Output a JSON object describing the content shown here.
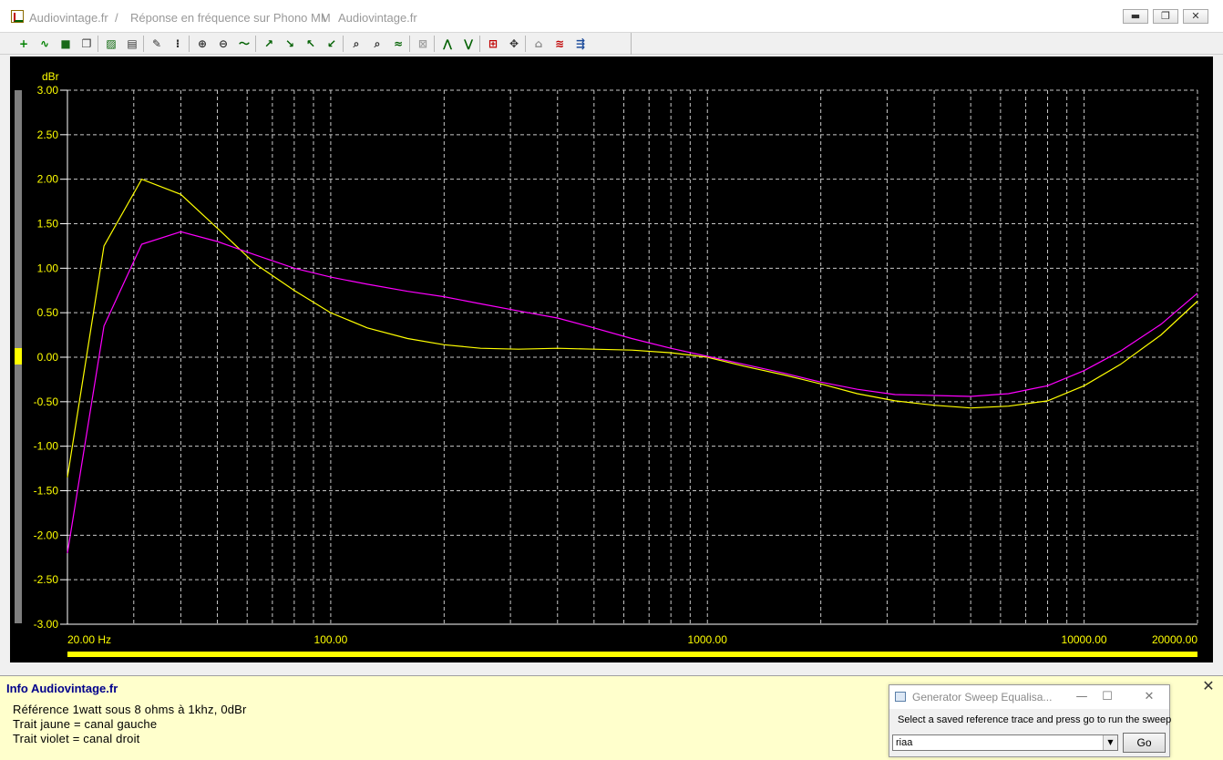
{
  "window": {
    "title_parts": [
      "Audiovintage.fr",
      "/",
      "Réponse en fréquence sur Phono MM",
      "\\",
      "Audiovintage.fr"
    ]
  },
  "window_controls": {
    "minimize": "▬",
    "restore": "❐",
    "close": "✕"
  },
  "toolbar": {
    "groups": [
      [
        {
          "name": "add-trace-icon",
          "glyph": "+",
          "color": "#008000"
        },
        {
          "name": "wave-icon",
          "glyph": "∿",
          "color": "#008000"
        },
        {
          "name": "save-icon",
          "glyph": "■",
          "color": "#1a6a1a"
        },
        {
          "name": "copy-icon",
          "glyph": "❐",
          "color": "#333333"
        }
      ],
      [
        {
          "name": "graph-view-icon",
          "glyph": "▨",
          "color": "#006000"
        },
        {
          "name": "graph-compare-icon",
          "glyph": "▤",
          "color": "#333333"
        }
      ],
      [
        {
          "name": "edit-sheet-icon",
          "glyph": "✎",
          "color": "#333333"
        },
        {
          "name": "data-table-icon",
          "glyph": "⁝",
          "color": "#333333"
        }
      ],
      [
        {
          "name": "zoom-in-icon",
          "glyph": "⊕",
          "color": "#333333"
        },
        {
          "name": "zoom-out-icon",
          "glyph": "⊖",
          "color": "#333333"
        },
        {
          "name": "zoom-fit-icon",
          "glyph": "〜",
          "color": "#006000"
        }
      ],
      [
        {
          "name": "trace-up-icon",
          "glyph": "↗",
          "color": "#006000"
        },
        {
          "name": "trace-down-icon",
          "glyph": "↘",
          "color": "#006000"
        },
        {
          "name": "trace-left-icon",
          "glyph": "↖",
          "color": "#006000"
        },
        {
          "name": "trace-right-icon",
          "glyph": "↙",
          "color": "#006000"
        }
      ],
      [
        {
          "name": "magnify-plus-icon",
          "glyph": "⌕",
          "color": "#333333"
        },
        {
          "name": "magnify-minus-icon",
          "glyph": "⌕",
          "color": "#333333"
        },
        {
          "name": "scope-icon",
          "glyph": "≈",
          "color": "#006000"
        }
      ],
      [
        {
          "name": "disabled-tool-icon",
          "glyph": "⊠",
          "color": "#a0a0a0"
        }
      ],
      [
        {
          "name": "peak-up-icon",
          "glyph": "⋀",
          "color": "#006000"
        },
        {
          "name": "peak-down-icon",
          "glyph": "⋁",
          "color": "#006000"
        }
      ],
      [
        {
          "name": "marker-icon",
          "glyph": "⊞",
          "color": "#c00000"
        },
        {
          "name": "cursor-move-icon",
          "glyph": "✥",
          "color": "#333333"
        }
      ],
      [
        {
          "name": "shape-grey-icon",
          "glyph": "⌂",
          "color": "#909090"
        },
        {
          "name": "sweep-icon",
          "glyph": "≋",
          "color": "#c00000"
        },
        {
          "name": "settings-icon",
          "glyph": "⇶",
          "color": "#1a4a9a"
        }
      ]
    ]
  },
  "chart_data": {
    "type": "line",
    "ylabel": "dBr",
    "ylim": [
      -3.0,
      3.0
    ],
    "xlim": [
      20,
      20000
    ],
    "x_scale": "log",
    "grid": true,
    "y_ticks": [
      "3.00",
      "2.50",
      "2.00",
      "1.50",
      "1.00",
      "0.50",
      "0.00",
      "-0.50",
      "-1.00",
      "-1.50",
      "-2.00",
      "-2.50",
      "-3.00"
    ],
    "x_tick_labels": [
      {
        "value": 20,
        "label": "20.00 Hz"
      },
      {
        "value": 100,
        "label": "100.00"
      },
      {
        "value": 1000,
        "label": "1000.00"
      },
      {
        "value": 10000,
        "label": "10000.00"
      },
      {
        "value": 20000,
        "label": "20000.00"
      }
    ],
    "series": [
      {
        "color": "#ffff00",
        "points": [
          [
            20,
            -1.35
          ],
          [
            25,
            1.25
          ],
          [
            31.5,
            2.0
          ],
          [
            40,
            1.83
          ],
          [
            50,
            1.45
          ],
          [
            63,
            1.05
          ],
          [
            80,
            0.75
          ],
          [
            100,
            0.5
          ],
          [
            125,
            0.33
          ],
          [
            160,
            0.21
          ],
          [
            200,
            0.14
          ],
          [
            250,
            0.1
          ],
          [
            315,
            0.09
          ],
          [
            400,
            0.1
          ],
          [
            500,
            0.09
          ],
          [
            630,
            0.08
          ],
          [
            800,
            0.05
          ],
          [
            1000,
            0.0
          ],
          [
            1250,
            -0.1
          ],
          [
            1600,
            -0.2
          ],
          [
            2000,
            -0.3
          ],
          [
            2500,
            -0.41
          ],
          [
            3150,
            -0.49
          ],
          [
            4000,
            -0.54
          ],
          [
            5000,
            -0.57
          ],
          [
            6300,
            -0.55
          ],
          [
            8000,
            -0.49
          ],
          [
            10000,
            -0.32
          ],
          [
            12500,
            -0.08
          ],
          [
            16000,
            0.25
          ],
          [
            20000,
            0.63
          ]
        ]
      },
      {
        "color": "#ff00ff",
        "points": [
          [
            20,
            -2.2
          ],
          [
            25,
            0.35
          ],
          [
            31.5,
            1.27
          ],
          [
            40,
            1.41
          ],
          [
            50,
            1.3
          ],
          [
            63,
            1.15
          ],
          [
            80,
            1.0
          ],
          [
            100,
            0.9
          ],
          [
            125,
            0.82
          ],
          [
            160,
            0.74
          ],
          [
            200,
            0.68
          ],
          [
            250,
            0.6
          ],
          [
            315,
            0.52
          ],
          [
            400,
            0.44
          ],
          [
            500,
            0.33
          ],
          [
            630,
            0.21
          ],
          [
            800,
            0.1
          ],
          [
            1000,
            0.01
          ],
          [
            1250,
            -0.08
          ],
          [
            1600,
            -0.18
          ],
          [
            2000,
            -0.28
          ],
          [
            2500,
            -0.36
          ],
          [
            3150,
            -0.42
          ],
          [
            4000,
            -0.43
          ],
          [
            5000,
            -0.44
          ],
          [
            6300,
            -0.41
          ],
          [
            8000,
            -0.32
          ],
          [
            10000,
            -0.15
          ],
          [
            12500,
            0.07
          ],
          [
            16000,
            0.37
          ],
          [
            20000,
            0.72
          ]
        ]
      }
    ]
  },
  "info": {
    "title": "Info Audiovintage.fr",
    "lines": [
      "Référence 1watt sous 8 ohms à 1khz, 0dBr",
      "Trait jaune = canal gauche",
      "Trait violet = canal droit"
    ],
    "close_glyph": "✕"
  },
  "dialog": {
    "title": "Generator Sweep Equalisa...",
    "prompt": "Select a saved reference trace and press go to run the sweep",
    "select_value": "riaa",
    "go_label": "Go",
    "min_glyph": "—",
    "max_glyph": "☐",
    "close_glyph": "✕"
  }
}
